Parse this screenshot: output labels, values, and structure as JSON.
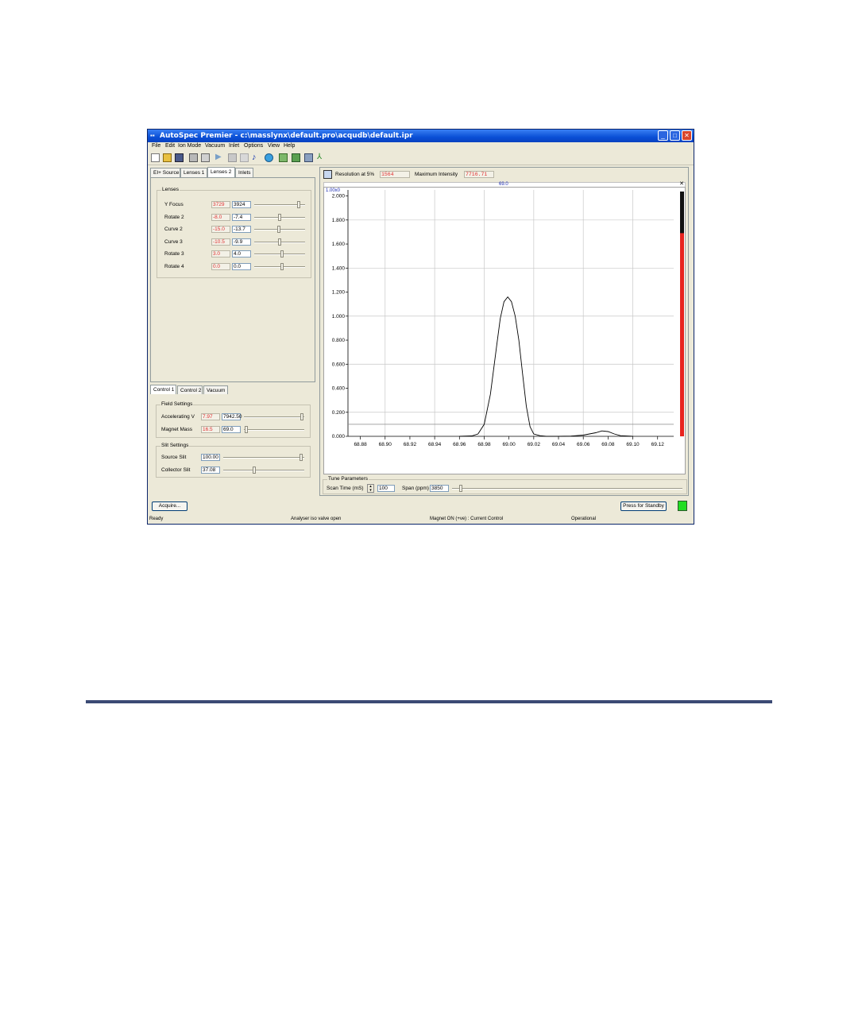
{
  "window": {
    "title": "AutoSpec Premier - c:\\masslynx\\default.pro\\acqudb\\default.ipr",
    "controls": [
      "_",
      "□",
      "✕"
    ]
  },
  "menu": [
    "File",
    "Edit",
    "Ion Mode",
    "Vacuum",
    "Inlet",
    "Options",
    "View",
    "Help"
  ],
  "toolbar": {
    "icons": [
      "new-icon",
      "open-icon",
      "save-icon",
      "print-icon",
      "print-preview-icon",
      "play-icon",
      "stop-icon",
      "pause-icon",
      "note-icon",
      "globe-icon",
      "tune-icon",
      "monitor-icon",
      "calibrate-icon",
      "peak-icon"
    ]
  },
  "left_tabs": [
    "EI+ Source",
    "Lenses 1",
    "Lenses 2",
    "Inlets"
  ],
  "left_active_tab": "Lenses 2",
  "lenses": {
    "group_title": "Lenses",
    "rows": [
      {
        "label": "Y Focus",
        "readback": "3729",
        "setpoint": "3924",
        "level": 0.9
      },
      {
        "label": "Rotate 2",
        "readback": "-8.0",
        "setpoint": "-7.4",
        "level": 0.5
      },
      {
        "label": "Curve 2",
        "readback": "-15.0",
        "setpoint": "-13.7",
        "level": 0.48
      },
      {
        "label": "Curve 3",
        "readback": "-10.5",
        "setpoint": "-9.9",
        "level": 0.5
      },
      {
        "label": "Rotate 3",
        "readback": "3.0",
        "setpoint": "4.0",
        "level": 0.55
      },
      {
        "label": "Rotate 4",
        "readback": "0.0",
        "setpoint": "0.0",
        "level": 0.55
      }
    ]
  },
  "control_tabs": [
    "Control 1",
    "Control 2",
    "Vacuum"
  ],
  "field_settings": {
    "group_title": "Field Settings",
    "rows": [
      {
        "label": "Accelerating V",
        "readback": "7.97",
        "setpoint": "7942.50",
        "level": 0.98
      },
      {
        "label": "Magnet Mass",
        "readback": "16.5",
        "setpoint": "69.0",
        "level": 0.02
      }
    ]
  },
  "slit_settings": {
    "group_title": "Slit Settings",
    "rows": [
      {
        "label": "Source Slit",
        "setpoint": "100.00",
        "level": 0.98
      },
      {
        "label": "Collector Slit",
        "setpoint": "37.08",
        "level": 0.38
      }
    ]
  },
  "peak_info": {
    "resolution_label": "Resolution at 5%",
    "resolution_value": "1564",
    "max_intensity_label": "Maximum Intensity",
    "max_intensity_value": "7716.71",
    "center_mass": "69.0",
    "scale_label": "1.00x0"
  },
  "chart_data": {
    "type": "line",
    "x_ticks": [
      "68.88",
      "68.90",
      "68.92",
      "68.94",
      "68.96",
      "68.98",
      "69.00",
      "69.02",
      "69.04",
      "69.06",
      "69.08",
      "69.10",
      "69.12"
    ],
    "y_ticks": [
      "0.000",
      "0.200",
      "0.400",
      "0.600",
      "0.800",
      "1.000",
      "1.200",
      "1.400",
      "1.600",
      "1.800",
      "2.000"
    ],
    "xlim": [
      68.87,
      69.133
    ],
    "ylim": [
      0,
      2.05
    ],
    "series": [
      {
        "x": [
          68.96,
          68.97,
          68.975,
          68.98,
          68.985,
          68.99,
          68.993,
          68.996,
          68.999,
          69.002,
          69.005,
          69.008,
          69.011,
          69.014,
          69.017,
          69.02,
          69.025,
          69.03,
          69.04,
          69.05,
          69.06,
          69.07,
          69.075,
          69.08,
          69.085,
          69.09,
          69.1
        ],
        "y": [
          0.0,
          0.003,
          0.02,
          0.1,
          0.35,
          0.75,
          0.98,
          1.12,
          1.16,
          1.12,
          1.0,
          0.8,
          0.52,
          0.25,
          0.08,
          0.02,
          0.005,
          0.0,
          0.0,
          0.002,
          0.01,
          0.03,
          0.045,
          0.04,
          0.02,
          0.005,
          0.0
        ]
      }
    ],
    "threshold": 0.1,
    "grid": true
  },
  "intensity_bar": {
    "level": 0.83,
    "color": "#e8251f"
  },
  "tune_parameters": {
    "group_title": "Tune Parameters",
    "scan_time_label": "Scan Time (mS)",
    "scan_time_value": "100",
    "span_label": "Span (ppm)",
    "span_value": "3850",
    "span_level": 0.03
  },
  "buttons": {
    "acquire": "Acquire...",
    "standby": "Press for Standby"
  },
  "status_indicator_color": "#22dd22",
  "statusbar": [
    "Ready",
    "Analyser iso valve open",
    "Magnet ON (+ve) : Current Control",
    "Operational"
  ]
}
